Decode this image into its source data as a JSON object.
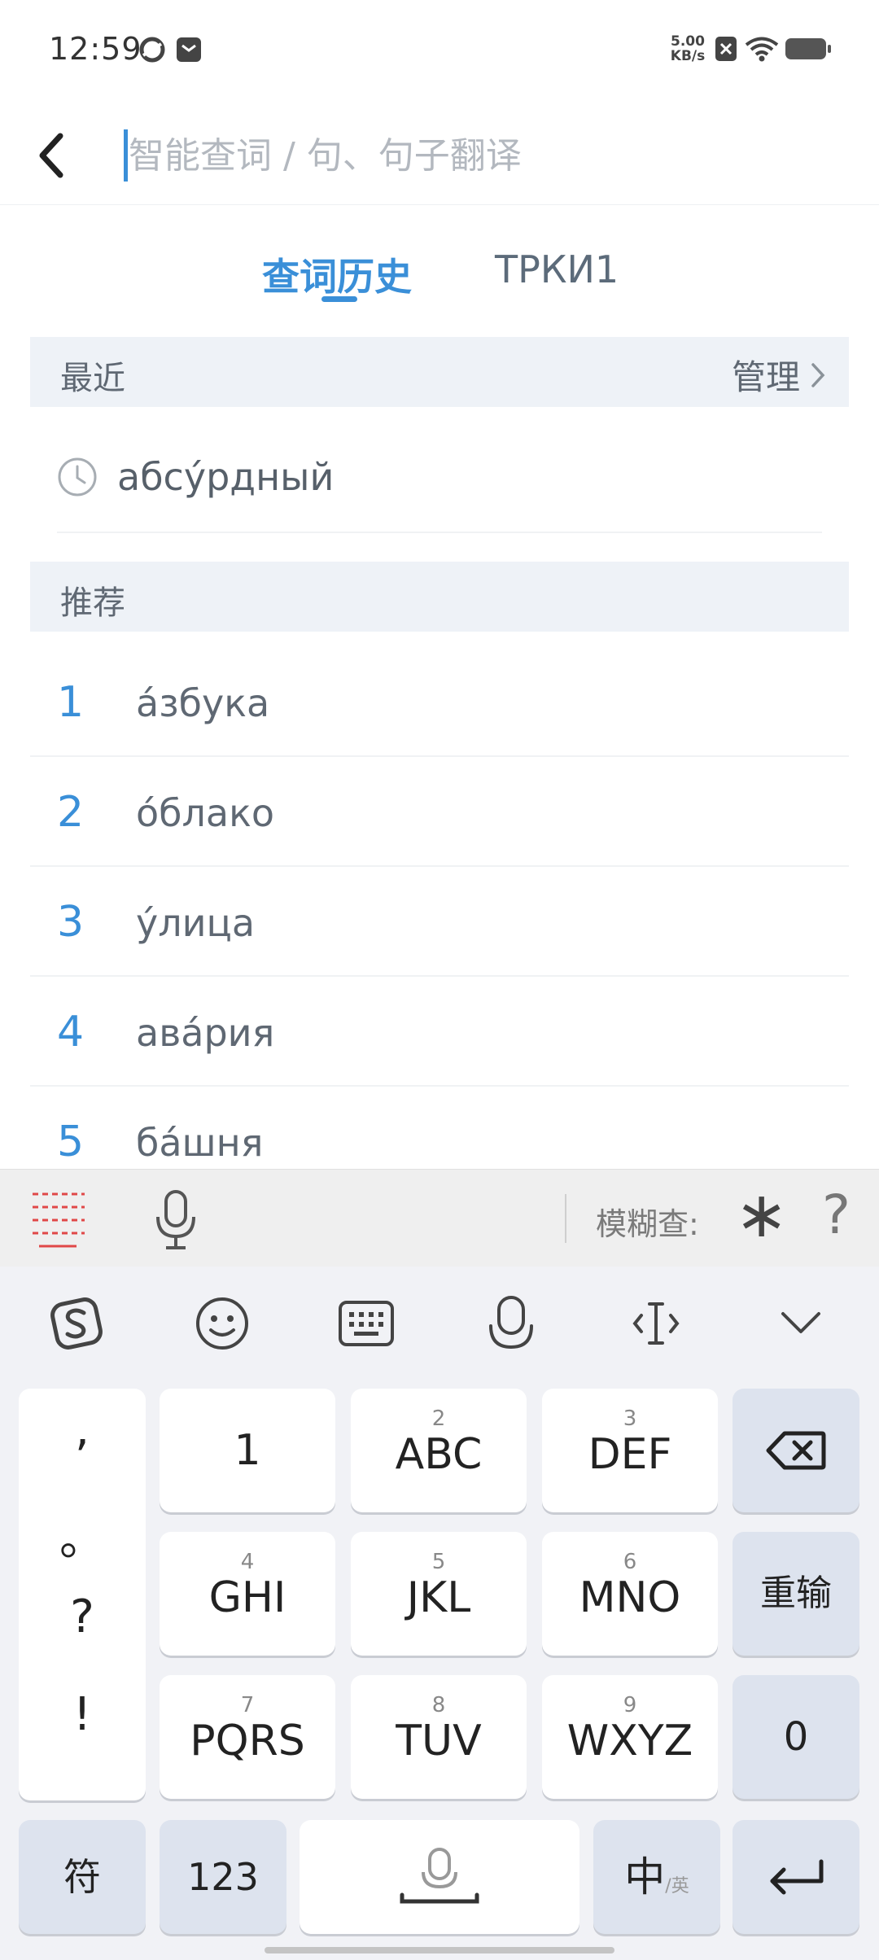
{
  "status": {
    "time": "12:59",
    "net_speed_value": "5.00",
    "net_speed_unit": "KB/s"
  },
  "search": {
    "placeholder": "智能查词 / 句、句子翻译",
    "value": ""
  },
  "tabs": [
    {
      "label": "查词历史",
      "active": true
    },
    {
      "label": "ТРКИ1",
      "active": false
    }
  ],
  "recent": {
    "title": "最近",
    "manage_label": "管理",
    "items": [
      {
        "word": "абсу́рдный"
      }
    ]
  },
  "recommended": {
    "title": "推荐",
    "items": [
      {
        "num": "1",
        "word": "а́збука"
      },
      {
        "num": "2",
        "word": "о́блако"
      },
      {
        "num": "3",
        "word": "у́лица"
      },
      {
        "num": "4",
        "word": "ава́рия"
      },
      {
        "num": "5",
        "word": "ба́шня"
      }
    ]
  },
  "ime_bar": {
    "fuzzy_label": "模糊查:",
    "wildcard_star": "∗",
    "wildcard_question": "?"
  },
  "keyboard": {
    "punctuation": [
      ",",
      "。",
      "?",
      "!"
    ],
    "keys": {
      "k1": {
        "sub": "",
        "main": "1"
      },
      "k2": {
        "sub": "2",
        "main": "ABC"
      },
      "k3": {
        "sub": "3",
        "main": "DEF"
      },
      "k4": {
        "sub": "4",
        "main": "GHI"
      },
      "k5": {
        "sub": "5",
        "main": "JKL"
      },
      "k6": {
        "sub": "6",
        "main": "MNO"
      },
      "k7": {
        "sub": "7",
        "main": "PQRS"
      },
      "k8": {
        "sub": "8",
        "main": "TUV"
      },
      "k9": {
        "sub": "9",
        "main": "WXYZ"
      }
    },
    "reinput_label": "重输",
    "zero_label": "0",
    "symbol_label": "符",
    "num_label": "123",
    "lang_main": "中",
    "lang_sub": "/英"
  },
  "colors": {
    "accent": "#3a8fd8",
    "section_bg": "#eef2f7",
    "keyboard_bg": "#f1f2f6",
    "function_key_bg": "#dde3ee",
    "toolbar_icon_red": "#e04848"
  }
}
